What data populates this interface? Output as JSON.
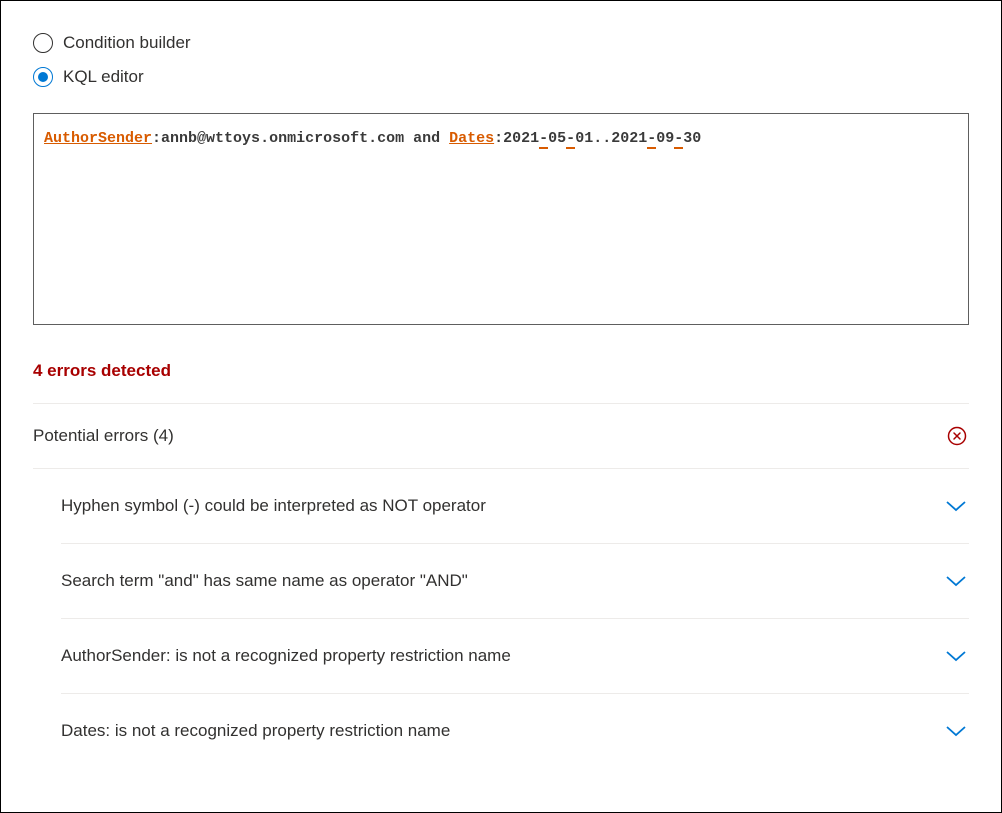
{
  "radios": {
    "conditionBuilder": "Condition builder",
    "kqlEditor": "KQL editor",
    "selected": "kql"
  },
  "query": {
    "token1": "AuthorSender",
    "sep1": ":",
    "token2": "annb@wttoys.onmicrosoft.com and ",
    "token3": "Dates",
    "sep2": ":",
    "part_2021a": "2021",
    "part_hyphen": "-",
    "part_05": "05",
    "part_01": "01",
    "part_dots": "..",
    "part_2021b": "2021",
    "part_09": "09",
    "part_30": "30",
    "part_3": "3",
    "part_0": "0"
  },
  "summary": "4 errors detected",
  "potentialErrorsHeader": "Potential errors (4)",
  "errors": [
    "Hyphen symbol (-) could be interpreted as NOT operator",
    "Search term \"and\" has same name as operator \"AND\"",
    "AuthorSender: is not a recognized property restriction name",
    "Dates: is not a recognized property restriction name"
  ],
  "colors": {
    "accent": "#0078d4",
    "error": "#a80000",
    "keyword": "#d85b00"
  }
}
